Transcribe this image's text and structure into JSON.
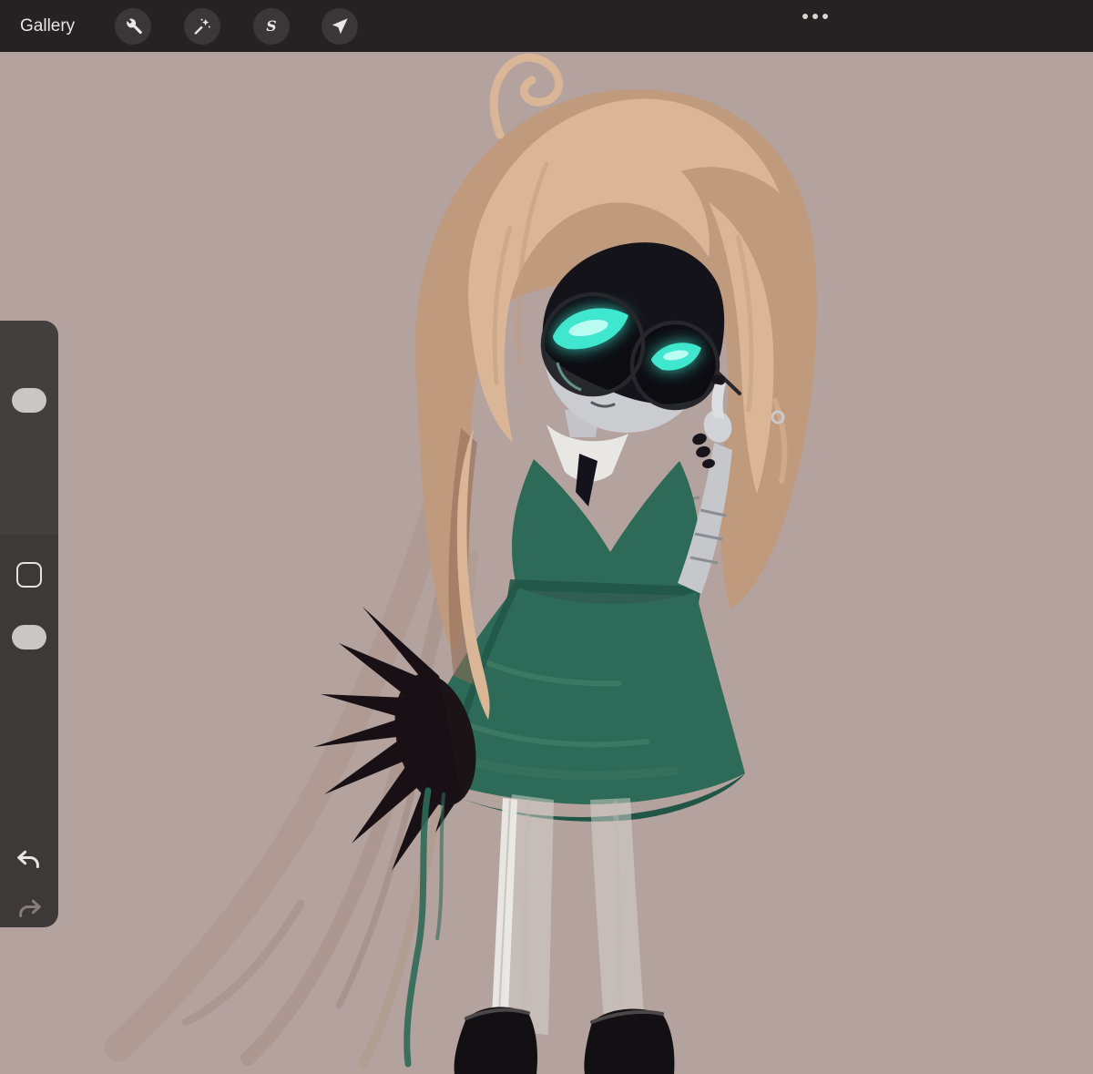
{
  "topbar": {
    "gallery_label": "Gallery",
    "icons": {
      "actions": "wrench-icon",
      "adjustments": "magic-wand-icon",
      "selection": "s-curve-icon",
      "transform": "cursor-arrow-icon",
      "more": "ellipsis-icon"
    }
  },
  "sidebar": {
    "icons": {
      "size_slider": "slider-handle",
      "modify": "square-outline-icon",
      "opacity_slider": "slider-handle",
      "undo": "undo-arrow-icon",
      "redo": "redo-arrow-icon"
    }
  },
  "canvas": {
    "colors": {
      "background": "#b3a29e",
      "hair": "#dab697",
      "hair_shadow": "#c09a7d",
      "face_light": "#cbccd0",
      "visor_dark": "#15131a",
      "eye_glow": "#40e7cf",
      "dress_green": "#2d6a57",
      "dress_shadow": "#215647",
      "metal_arm": "#c6c7cb",
      "boots": "#131013"
    }
  }
}
